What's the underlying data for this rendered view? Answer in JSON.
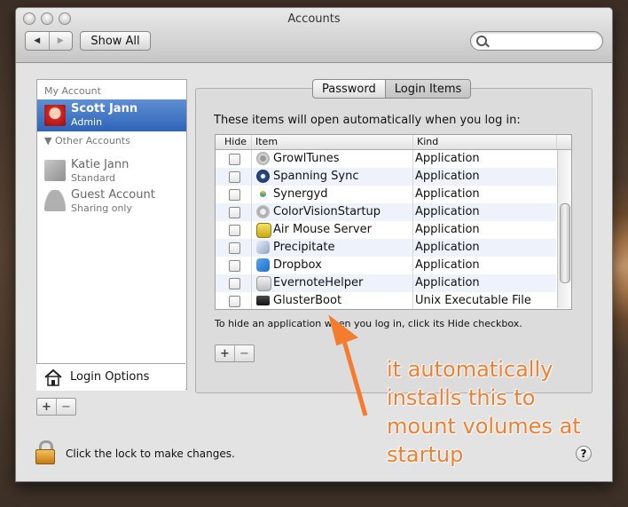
{
  "window": {
    "title": "Accounts"
  },
  "toolbar": {
    "show_all": "Show All",
    "search_placeholder": ""
  },
  "sidebar": {
    "section_my": "My Account",
    "section_other": "Other Accounts",
    "accounts": [
      {
        "name": "Scott Jann",
        "role": "Admin"
      },
      {
        "name": "Katie Jann",
        "role": "Standard"
      },
      {
        "name": "Guest Account",
        "role": "Sharing only"
      }
    ],
    "login_options": "Login Options"
  },
  "tabs": [
    "Password",
    "Login Items"
  ],
  "login_items": {
    "intro": "These items will open automatically when you log in:",
    "columns": [
      "Hide",
      "Item",
      "Kind"
    ],
    "rows": [
      {
        "name": "GrowlTunes",
        "kind": "Application",
        "icon": "growltunes-icon"
      },
      {
        "name": "Spanning Sync",
        "kind": "Application",
        "icon": "spanning-sync-icon"
      },
      {
        "name": "Synergyd",
        "kind": "Application",
        "icon": "synergy-icon"
      },
      {
        "name": "ColorVisionStartup",
        "kind": "Application",
        "icon": "colorvision-icon"
      },
      {
        "name": "Air Mouse Server",
        "kind": "Application",
        "icon": "air-mouse-icon"
      },
      {
        "name": "Precipitate",
        "kind": "Application",
        "icon": "precipitate-icon"
      },
      {
        "name": "Dropbox",
        "kind": "Application",
        "icon": "dropbox-icon"
      },
      {
        "name": "EvernoteHelper",
        "kind": "Application",
        "icon": "evernote-icon"
      },
      {
        "name": "GlusterBoot",
        "kind": "Unix Executable File",
        "icon": "terminal-icon"
      }
    ],
    "hint": "To hide an application when you log in, click its Hide checkbox."
  },
  "footer": {
    "lock_text": "Click the lock to make changes.",
    "help": "?"
  },
  "annotation": {
    "lines": [
      "it automatically",
      "installs this to",
      "mount volumes at",
      "startup"
    ],
    "color": "#f47c2e"
  }
}
